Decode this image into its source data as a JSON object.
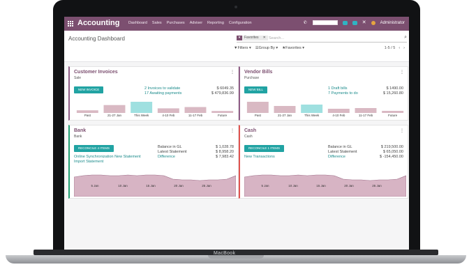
{
  "device": {
    "brand": "MacBook"
  },
  "topbar": {
    "app_title": "Accounting",
    "menu": [
      "Dashboard",
      "Sales",
      "Purchases",
      "Adviser",
      "Reporting",
      "Configuration"
    ],
    "user": "Administrator"
  },
  "control": {
    "title": "Accounting Dashboard",
    "search": {
      "facet_value": "Favorites",
      "placeholder": "Search..."
    },
    "filters_label": "Filters",
    "groupby_label": "Group By",
    "favorites_label": "Favorites",
    "pager": "1-5 / 5"
  },
  "colors": {
    "brand": "#7c4f70",
    "accent": "#21a3a3",
    "bar": "#d9b9c3",
    "bar_current": "#9fe0e0"
  },
  "journals": [
    {
      "title": "Customer Invoices",
      "subtitle": "Sale",
      "button": "NEW INVOICE",
      "links": [
        "2 Invoices to validate",
        "17 Awaiting payments"
      ],
      "amounts": [
        "$ 6049.35",
        "$ 479,836.99"
      ],
      "chart_labels": [
        "Past",
        "21-27 Jan",
        "This Week",
        "4-10 Feb",
        "11-17 Feb",
        "Future"
      ],
      "chart_values": [
        4,
        12,
        17,
        7,
        9,
        3
      ]
    },
    {
      "title": "Vendor Bills",
      "subtitle": "Purchase",
      "button": "NEW BILL",
      "links": [
        "1 Draft bills",
        "7 Payments to do"
      ],
      "amounts": [
        "$ 1490.00",
        "$ 15,260.80"
      ],
      "chart_labels": [
        "Past",
        "21-27 Jan",
        "This Week",
        "4-10 Feb",
        "11-17 Feb",
        "Future"
      ],
      "chart_values": [
        16,
        10,
        12,
        6,
        7,
        3
      ]
    },
    {
      "title": "Bank",
      "subtitle": "Bank",
      "button": "RECONCILE 4 ITEMS",
      "links": [
        "Online Synchronization New Statement",
        "Import Statement"
      ],
      "rows": [
        [
          "Balance in GL",
          "$ 1,028.78"
        ],
        [
          "Latest Statement",
          "$ 8,958.20"
        ],
        [
          "Difference",
          "$ 7,983.42"
        ]
      ],
      "chart_labels": [
        "5 Jan",
        "10 Jan",
        "15 Jan",
        "20 Jan",
        "25 Jan"
      ]
    },
    {
      "title": "Cash",
      "subtitle": "Cash",
      "button": "RECONCILE 1 ITEMS",
      "links": [
        "New Transactions"
      ],
      "rows": [
        [
          "Balance in GL",
          "$ 219,500.00"
        ],
        [
          "Latest Statement",
          "$ 65,050.00"
        ],
        [
          "Difference",
          "$ -154,450.00"
        ]
      ],
      "chart_labels": [
        "5 Jan",
        "10 Jan",
        "15 Jan",
        "20 Jan",
        "25 Jan"
      ]
    }
  ]
}
